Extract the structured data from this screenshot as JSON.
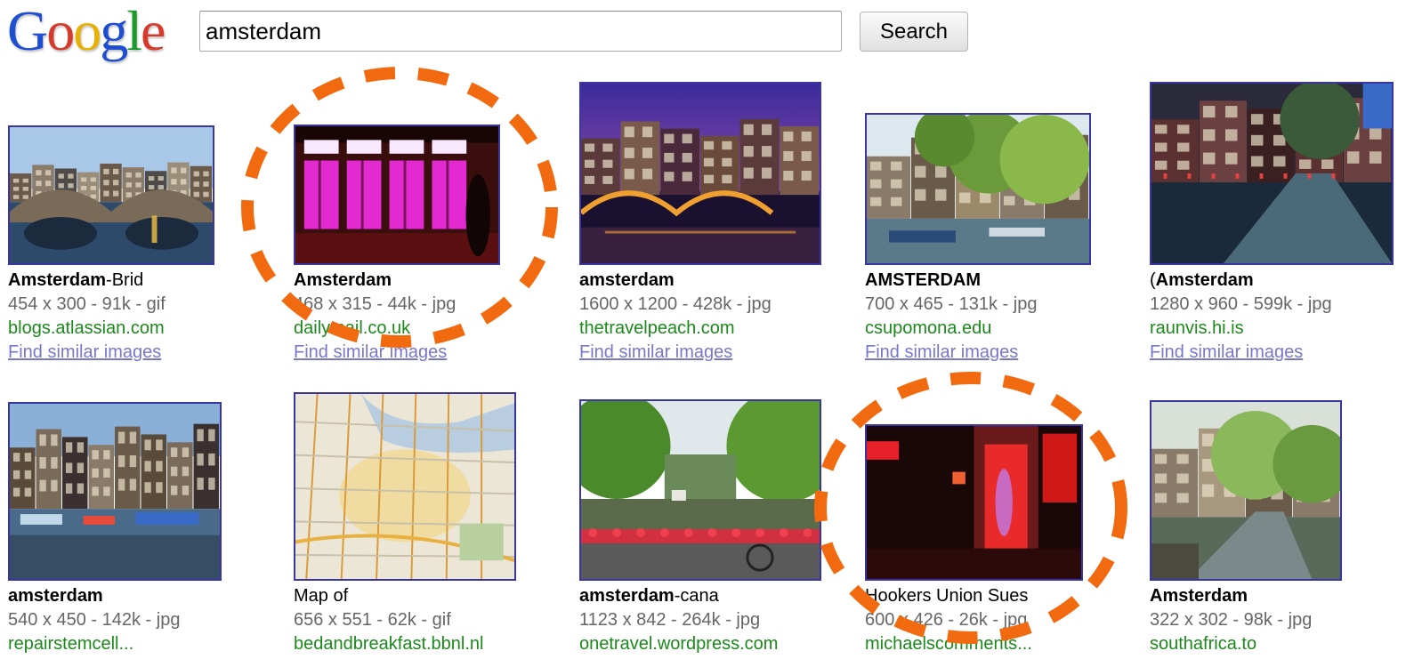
{
  "header": {
    "logo": {
      "text": "Google",
      "letters": [
        {
          "ch": "G",
          "color": "#1f4fd0"
        },
        {
          "ch": "o",
          "color": "#d63a2a"
        },
        {
          "ch": "o",
          "color": "#e8b000"
        },
        {
          "ch": "g",
          "color": "#1f4fd0"
        },
        {
          "ch": "l",
          "color": "#1c9a2e"
        },
        {
          "ch": "e",
          "color": "#d63a2a"
        }
      ]
    },
    "search": {
      "value": "amsterdam"
    },
    "search_button": "Search"
  },
  "colors": {
    "thumb_border": "#3a35a5",
    "meta_text": "#666666",
    "site_text": "#1a8a1a",
    "link_text": "#7777cc",
    "annotation": "#f26a10"
  },
  "results": [
    {
      "title_bold": "Amsterdam",
      "title_rest": "-Brid",
      "meta": "454 x 300 - 91k - gif",
      "site": "blogs.atlassian.com",
      "similar": "Find similar images",
      "scene": "canal-bridge",
      "annotated": false
    },
    {
      "title_bold": "Amsterdam",
      "title_rest": "",
      "meta": "468 x 315 - 44k - jpg",
      "site": "dailymail.co.uk",
      "similar": "Find similar images",
      "scene": "red-light-windows",
      "annotated": true
    },
    {
      "title_bold": "amsterdam",
      "title_rest": "",
      "meta": "1600 x 1200 - 428k - jpg",
      "site": "thetravelpeach.com",
      "similar": "Find similar images",
      "scene": "night-canal-houses",
      "annotated": false
    },
    {
      "title_bold": "AMSTERDAM",
      "title_rest": "",
      "meta": "700 x 465 - 131k - jpg",
      "site": "csupomona.edu",
      "similar": "Find similar images",
      "scene": "tree-lined-canal",
      "annotated": false
    },
    {
      "title_bold": "Amsterdam",
      "title_rest": "(",
      "title_prefix": true,
      "meta": "1280 x 960 - 599k - jpg",
      "site": "raunvis.hi.is",
      "similar": "Find similar images",
      "scene": "evening-canal-street",
      "annotated": false
    },
    {
      "title_bold": "amsterdam",
      "title_rest": "",
      "meta": "540 x 450 - 142k - jpg",
      "site": "repairstemcell...",
      "similar": "",
      "scene": "canal-houses-boats",
      "annotated": false
    },
    {
      "title_bold": "",
      "title_rest": "Map of",
      "meta": "656 x 551 - 62k - gif",
      "site": "bedandbreakfast.bbnl.nl",
      "similar": "",
      "scene": "city-map",
      "annotated": false
    },
    {
      "title_bold": "amsterdam",
      "title_rest": "-cana",
      "meta": "1123 x 842 - 264k - jpg",
      "site": "onetravel.wordpress.com",
      "similar": "",
      "scene": "canal-flowers-bikes",
      "annotated": false
    },
    {
      "title_bold": "",
      "title_rest": "Hookers Union Sues",
      "meta": "600 x 426 - 26k - jpg",
      "site": "michaelscomments...",
      "similar": "",
      "scene": "red-light-doorway",
      "annotated": true
    },
    {
      "title_bold": "Amsterdam",
      "title_rest": "",
      "meta": "322 x 302 - 98k - jpg",
      "site": "southafrica.to",
      "similar": "",
      "scene": "quiet-canal",
      "annotated": false
    }
  ]
}
